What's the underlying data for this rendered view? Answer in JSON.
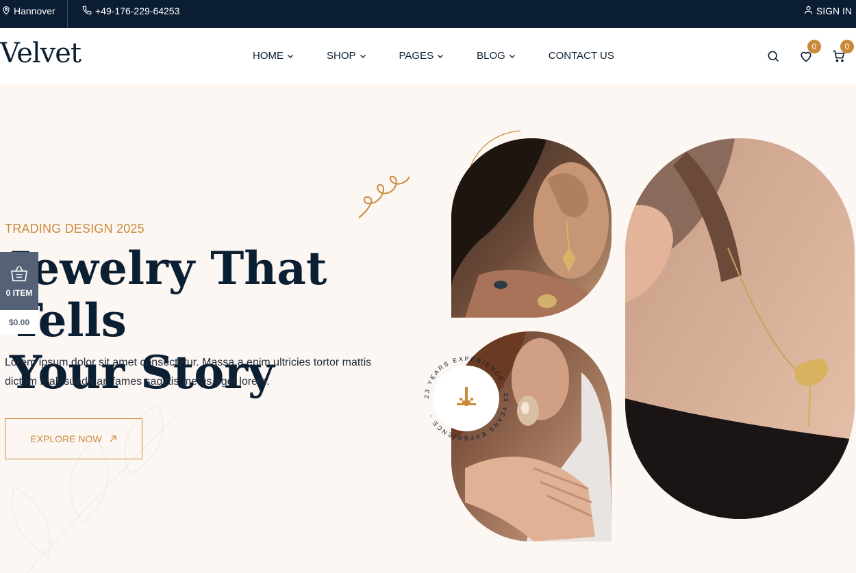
{
  "topbar": {
    "location": "Hannover",
    "phone": "+49-176-229-64253",
    "signin": "SIGN IN"
  },
  "header": {
    "logo": "Velvet",
    "nav": [
      {
        "label": "HOME",
        "has_dropdown": true
      },
      {
        "label": "SHOP",
        "has_dropdown": true
      },
      {
        "label": "PAGES",
        "has_dropdown": true
      },
      {
        "label": "BLOG",
        "has_dropdown": true
      },
      {
        "label": "CONTACT US",
        "has_dropdown": false
      }
    ],
    "wishlist_count": "0",
    "cart_count": "0"
  },
  "hero": {
    "subtitle": "TRADING DESIGN 2025",
    "title_line1": "Jewelry That Tells",
    "title_line2": "Your Story",
    "description": "Lorem ipsum dolor sit amet consectetur. Massa a enim ultricies tortor mattis dictum malesuada an fames sagittis metus eget lorem.",
    "cta": "EXPLORE NOW",
    "badge_text": "23 YEARS EXPERIENCE - 23 YEARS EXPERIENCE - "
  },
  "cart_widget": {
    "items": "0 ITEM",
    "total": "$0.00"
  },
  "colors": {
    "navy": "#0b1d33",
    "accent": "#c98a3a",
    "hero_bg": "#fdf7f4",
    "widget_bg": "#556176"
  }
}
